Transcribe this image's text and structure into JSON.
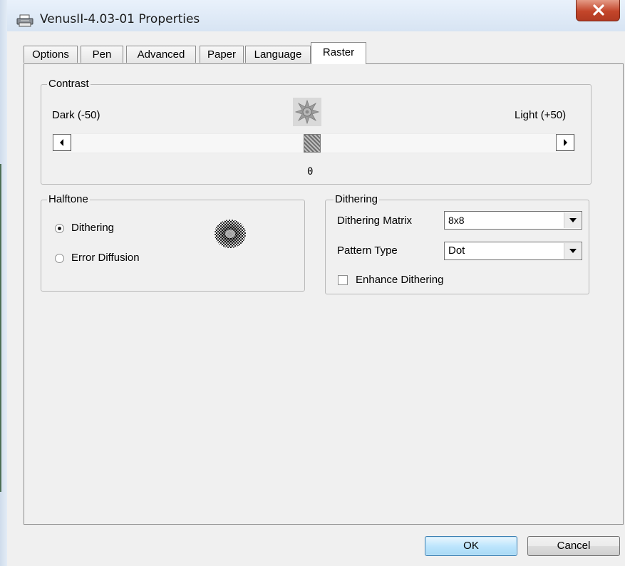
{
  "window": {
    "title": "VenusII-4.03-01 Properties"
  },
  "tabs": [
    {
      "label": "Options",
      "active": false
    },
    {
      "label": "Pen",
      "active": false
    },
    {
      "label": "Advanced",
      "active": false
    },
    {
      "label": "Paper",
      "active": false
    },
    {
      "label": "Language",
      "active": false
    },
    {
      "label": "Raster",
      "active": true
    }
  ],
  "contrast": {
    "group_label": "Contrast",
    "min_label": "Dark (-50)",
    "max_label": "Light (+50)",
    "value": "0"
  },
  "halftone": {
    "group_label": "Halftone",
    "options": [
      {
        "label": "Dithering",
        "selected": true
      },
      {
        "label": "Error Diffusion",
        "selected": false
      }
    ]
  },
  "dithering": {
    "group_label": "Dithering",
    "matrix_label": "Dithering Matrix",
    "matrix_value": "8x8",
    "pattern_label": "Pattern Type",
    "pattern_value": "Dot",
    "enhance_label": "Enhance Dithering",
    "enhance_checked": false
  },
  "buttons": {
    "ok": "OK",
    "cancel": "Cancel"
  },
  "colors": {
    "close_button": "#c3452a",
    "ok_border": "#3c7fb1"
  }
}
